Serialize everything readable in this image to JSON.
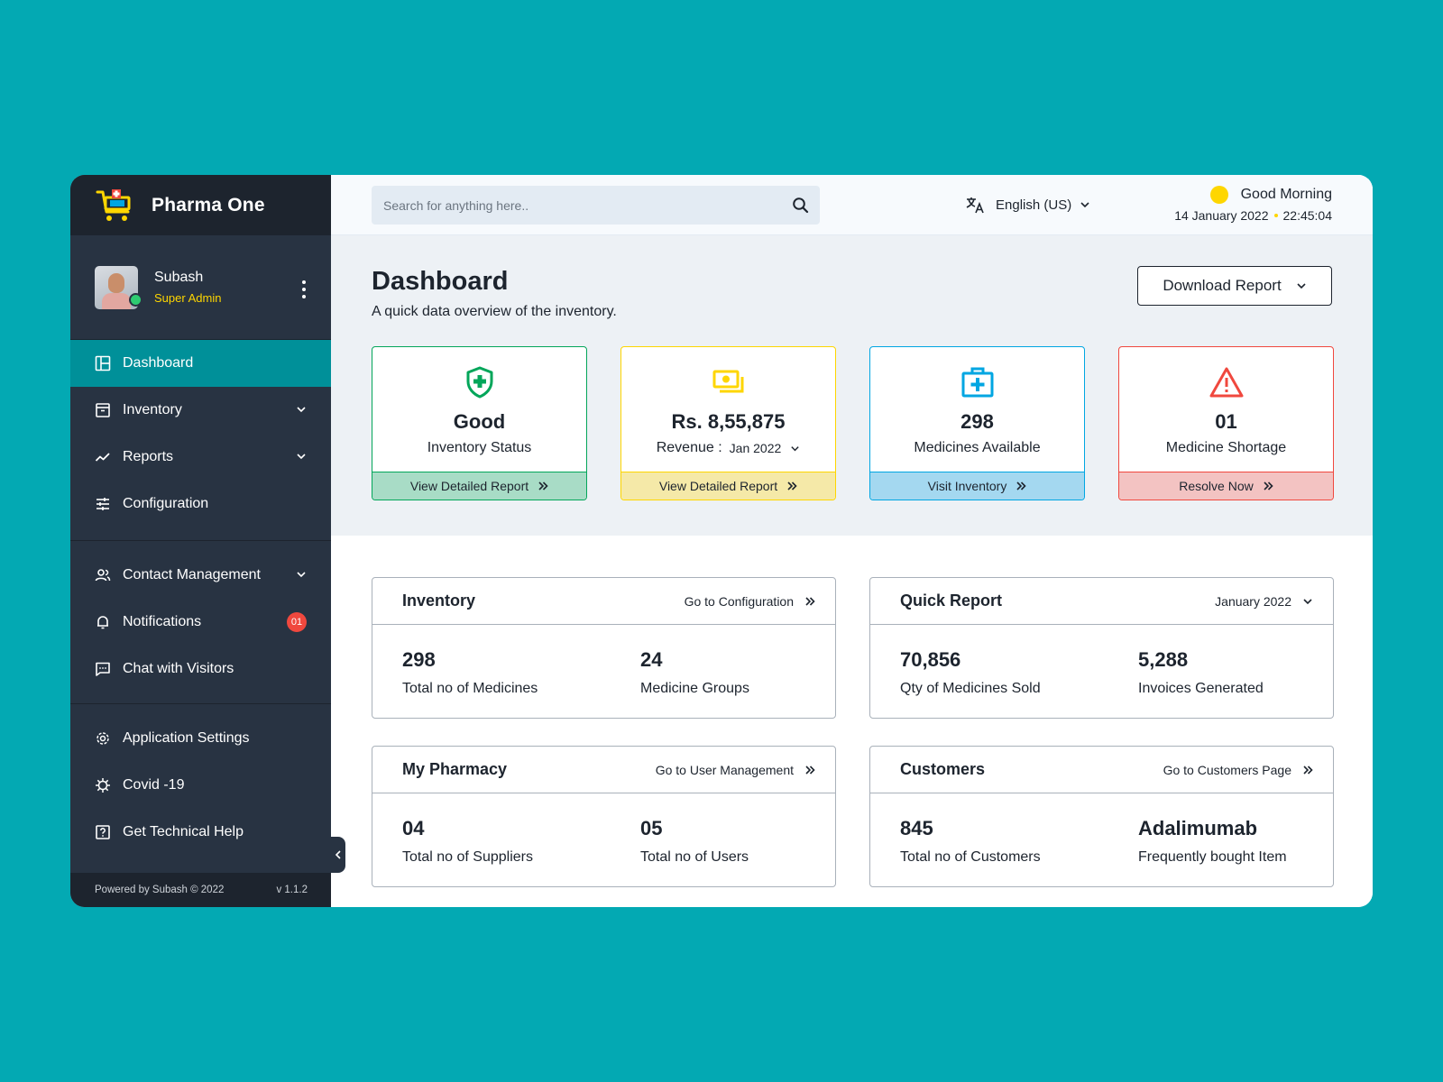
{
  "brand": {
    "name": "Pharma One"
  },
  "user": {
    "name": "Subash",
    "role": "Super Admin"
  },
  "nav": {
    "primary": [
      {
        "label": "Dashboard",
        "icon": "dashboard-icon",
        "active": true
      },
      {
        "label": "Inventory",
        "icon": "inventory-icon",
        "has_dropdown": true
      },
      {
        "label": "Reports",
        "icon": "reports-icon",
        "has_dropdown": true
      },
      {
        "label": "Configuration",
        "icon": "configuration-icon"
      }
    ],
    "secondary": [
      {
        "label": "Contact Management",
        "icon": "contacts-icon",
        "has_dropdown": true
      },
      {
        "label": "Notifications",
        "icon": "bell-icon",
        "badge": "01"
      },
      {
        "label": "Chat with Visitors",
        "icon": "chat-icon"
      }
    ],
    "tertiary": [
      {
        "label": "Application Settings",
        "icon": "gear-icon"
      },
      {
        "label": "Covid -19",
        "icon": "virus-icon"
      },
      {
        "label": "Get Technical Help",
        "icon": "help-icon"
      }
    ]
  },
  "footer": {
    "powered_by": "Powered by Subash © 2022",
    "version": "v 1.1.2"
  },
  "search": {
    "placeholder": "Search for anything here.."
  },
  "language": {
    "label": "English (US)"
  },
  "greeting": {
    "text": "Good Morning",
    "date": "14 January 2022",
    "time": "22:45:04"
  },
  "header": {
    "title": "Dashboard",
    "subtitle": "A quick data overview of the inventory.",
    "download_label": "Download Report"
  },
  "stat_cards": [
    {
      "value": "Good",
      "label": "Inventory Status",
      "action": "View Detailed Report",
      "icon": "shield-plus-icon",
      "color": "#03A65A"
    },
    {
      "value": "Rs. 8,55,875",
      "label": "Revenue :",
      "month": "Jan 2022",
      "action": "View Detailed Report",
      "icon": "money-icon",
      "color": "#FED600"
    },
    {
      "value": "298",
      "label": "Medicines Available",
      "action": "Visit Inventory",
      "icon": "medkit-icon",
      "color": "#01A6E2"
    },
    {
      "value": "01",
      "label": "Medicine Shortage",
      "action": "Resolve Now",
      "icon": "warning-icon",
      "color": "#F0483E"
    }
  ],
  "panels": {
    "inventory": {
      "title": "Inventory",
      "link": "Go to Configuration",
      "stats": [
        {
          "value": "298",
          "label": "Total no of Medicines"
        },
        {
          "value": "24",
          "label": "Medicine Groups"
        }
      ]
    },
    "quick_report": {
      "title": "Quick Report",
      "period": "January 2022",
      "stats": [
        {
          "value": "70,856",
          "label": "Qty of Medicines Sold"
        },
        {
          "value": "5,288",
          "label": "Invoices Generated"
        }
      ]
    },
    "pharmacy": {
      "title": "My Pharmacy",
      "link": "Go to User Management",
      "stats": [
        {
          "value": "04",
          "label": "Total no of Suppliers"
        },
        {
          "value": "05",
          "label": "Total no of Users"
        }
      ]
    },
    "customers": {
      "title": "Customers",
      "link": "Go to Customers Page",
      "stats": [
        {
          "value": "845",
          "label": "Total no of Customers"
        },
        {
          "value": "Adalimumab",
          "label": "Frequently bought Item"
        }
      ]
    }
  }
}
